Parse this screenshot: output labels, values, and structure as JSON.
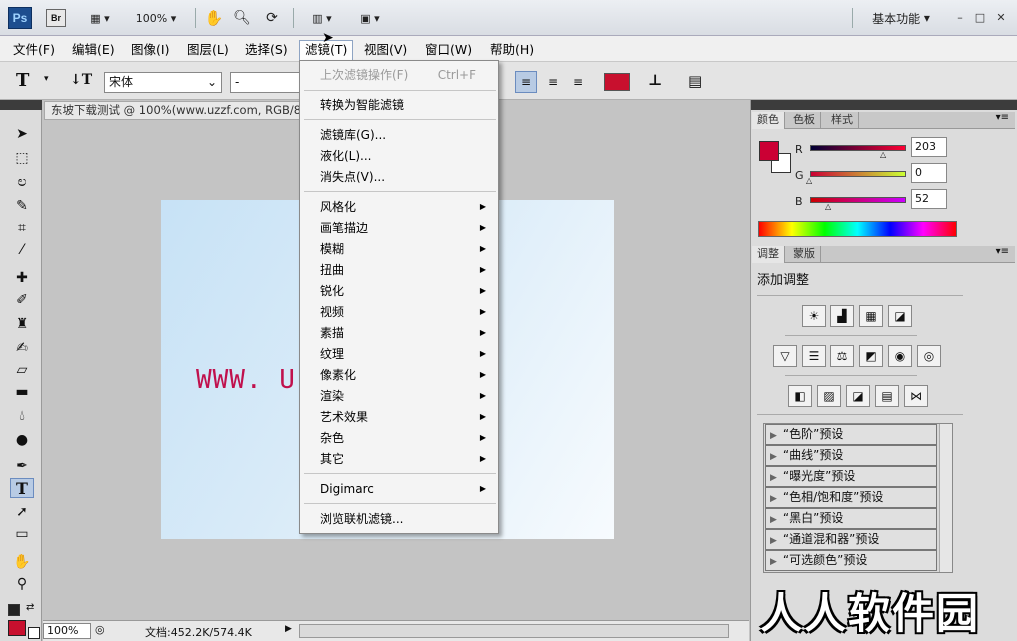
{
  "appbar": {
    "ps": "Ps",
    "br": "Br",
    "zoom": "100%",
    "workspace": "基本功能"
  },
  "menubar": {
    "items": [
      "文件(F)",
      "编辑(E)",
      "图像(I)",
      "图层(L)",
      "选择(S)",
      "滤镜(T)",
      "视图(V)",
      "窗口(W)",
      "帮助(H)"
    ],
    "active": "滤镜(T)"
  },
  "options": {
    "font_family": "宋体",
    "font_style": "-",
    "color": "#c8102e"
  },
  "document": {
    "tab_title": "东坡下载测试 @ 100%(www.uzzf.com, RGB/8)",
    "canvas_text": "WWW. U"
  },
  "status": {
    "zoom": "100%",
    "doc_info": "文档:452.2K/574.4K"
  },
  "filter_menu": {
    "last_filter": "上次滤镜操作(F)",
    "last_shortcut": "Ctrl+F",
    "smart": "转换为智能滤镜",
    "group1": [
      "滤镜库(G)...",
      "液化(L)...",
      "消失点(V)..."
    ],
    "group2": [
      "风格化",
      "画笔描边",
      "模糊",
      "扭曲",
      "锐化",
      "视频",
      "素描",
      "纹理",
      "像素化",
      "渲染",
      "艺术效果",
      "杂色",
      "其它"
    ],
    "digimarc": "Digimarc",
    "browse": "浏览联机滤镜..."
  },
  "color_panel": {
    "tabs": [
      "颜色",
      "色板",
      "样式"
    ],
    "r_label": "R",
    "g_label": "G",
    "b_label": "B",
    "r": "203",
    "g": "0",
    "b": "52",
    "fg": "#cb0034"
  },
  "adjust_panel": {
    "tabs": [
      "调整",
      "蒙版"
    ],
    "title": "添加调整",
    "presets": [
      "“色阶”预设",
      "“曲线”预设",
      "“曝光度”预设",
      "“色相/饱和度”预设",
      "“黑白”预设",
      "“通道混和器”预设",
      "“可选颜色”预设"
    ]
  },
  "watermark": "人人软件园"
}
